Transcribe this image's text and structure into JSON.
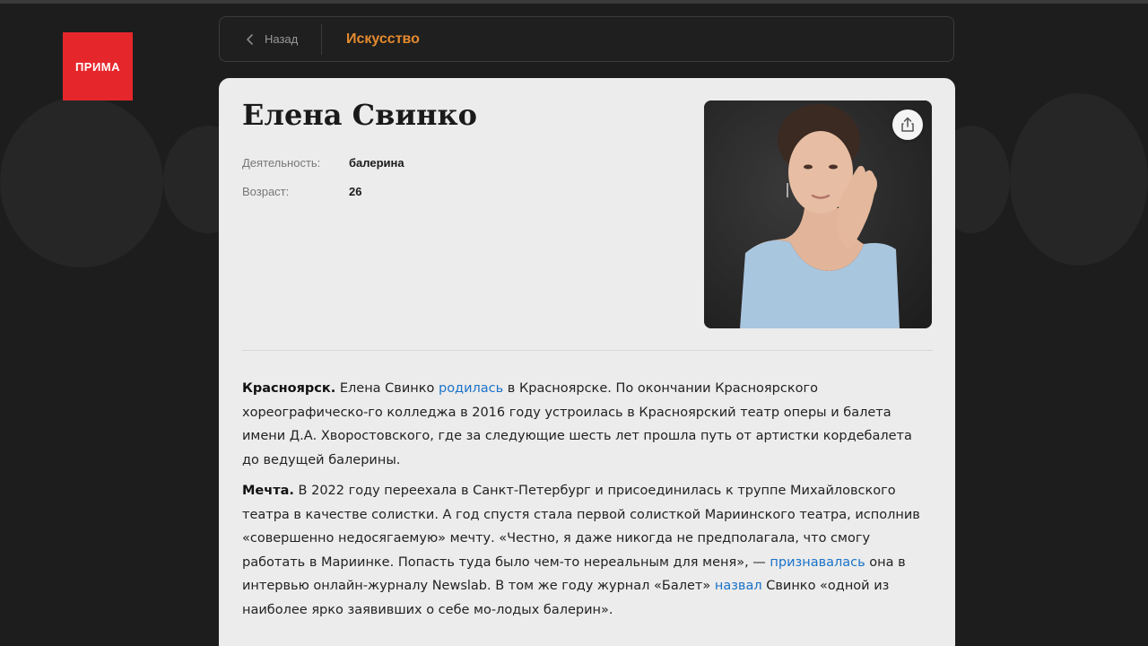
{
  "brand": {
    "logo_text": "ПРИМА"
  },
  "nav": {
    "back_label": "Назад",
    "category": "Искусство"
  },
  "profile": {
    "name": "Елена Свинко",
    "fields": [
      {
        "label": "Деятельность:",
        "value": "балерина"
      },
      {
        "label": "Возраст:",
        "value": "26"
      }
    ]
  },
  "article": {
    "p1": {
      "heading": "Красноярск.",
      "t1": "Елена Свинко",
      "link1": "родилась",
      "t2": "в Красноярске. По окончании Красноярского хореографическо-го колледжа в 2016 году устроилась в Красноярский театр оперы и балета имени Д.А. Хворостовского, где за следующие шесть лет прошла путь от артистки кордебалета до ведущей балерины."
    },
    "p2": {
      "heading": "Мечта.",
      "t1": "В 2022 году переехала в Санкт-Петербург и присоединилась к труппе Михайловского театра в качестве солистки. А год спустя стала первой солисткой Мариинского театра, исполнив «совершенно недосягаемую» мечту. «Честно, я даже никогда не предполагала, что смогу работать в Мариинке. Попасть туда было чем-то нереальным для меня», —",
      "link1": "признавалась",
      "t2": "она в интервью онлайн-журналу Newslab. В том же году журнал «Балет»",
      "link2": "назвал",
      "t3": "Свинко «одной из наиболее ярко заявивших о себе мо-лодых балерин»."
    }
  },
  "icons": {
    "back": "chevron-left-icon",
    "share": "share-icon"
  },
  "colors": {
    "accent": "#e58a2e",
    "brand_red": "#e5272c",
    "link": "#1a73c8",
    "background": "#1d1d1d",
    "card": "#ececec"
  }
}
